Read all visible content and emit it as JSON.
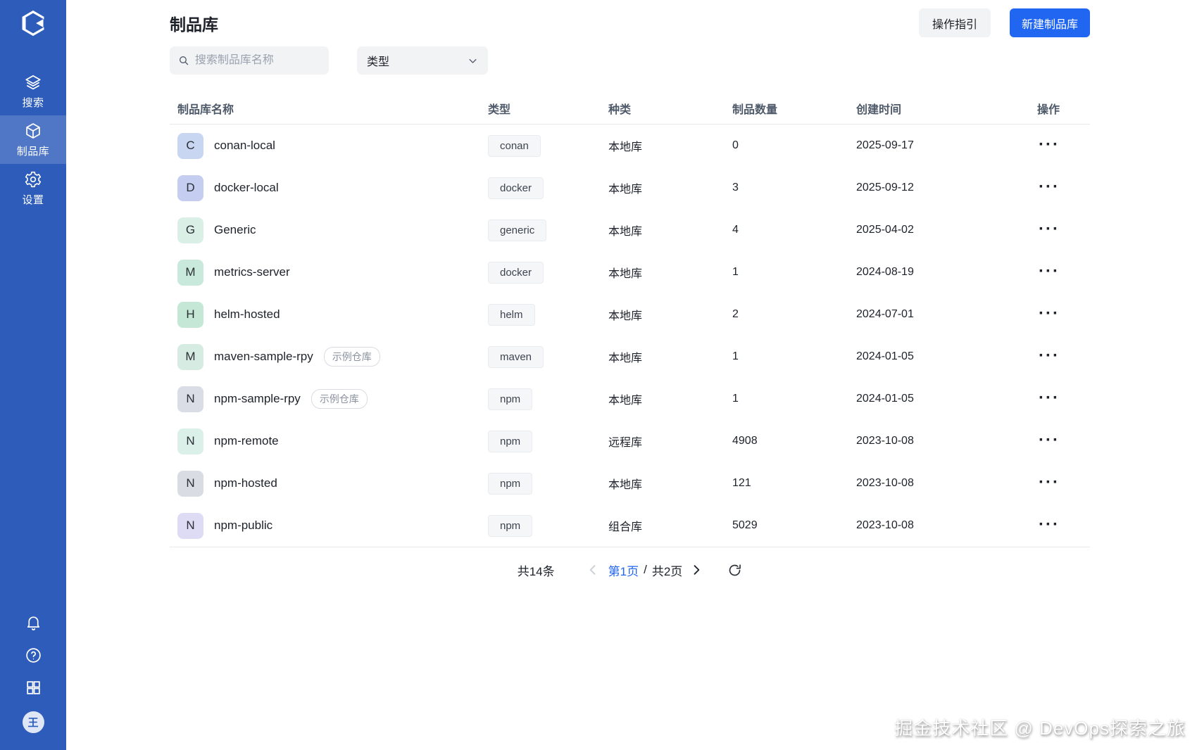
{
  "sidebar": {
    "items": [
      {
        "id": "search",
        "label": "搜索",
        "active": false
      },
      {
        "id": "artifacts",
        "label": "制品库",
        "active": true
      },
      {
        "id": "settings",
        "label": "设置",
        "active": false
      }
    ],
    "avatar_text": "王"
  },
  "header": {
    "title": "制品库",
    "guide_button_label": "操作指引",
    "create_button_label": "新建制品库"
  },
  "filters": {
    "search_placeholder": "搜索制品库名称",
    "search_value": "",
    "type_filter_label": "类型"
  },
  "table": {
    "columns": [
      "制品库名称",
      "类型",
      "种类",
      "制品数量",
      "创建时间",
      "操作"
    ],
    "action_label": "···",
    "rows": [
      {
        "initial": "C",
        "avatar_color": "#c9d6f2",
        "name": "conan-local",
        "badge": "",
        "type": "conan",
        "kind": "本地库",
        "count": "0",
        "created": "2025-09-17"
      },
      {
        "initial": "D",
        "avatar_color": "#c5cdf0",
        "name": "docker-local",
        "badge": "",
        "type": "docker",
        "kind": "本地库",
        "count": "3",
        "created": "2025-09-12"
      },
      {
        "initial": "G",
        "avatar_color": "#daf0e7",
        "name": "Generic",
        "badge": "",
        "type": "generic",
        "kind": "本地库",
        "count": "4",
        "created": "2025-04-02"
      },
      {
        "initial": "M",
        "avatar_color": "#c8e9db",
        "name": "metrics-server",
        "badge": "",
        "type": "docker",
        "kind": "本地库",
        "count": "1",
        "created": "2024-08-19"
      },
      {
        "initial": "H",
        "avatar_color": "#c4e7d6",
        "name": "helm-hosted",
        "badge": "",
        "type": "helm",
        "kind": "本地库",
        "count": "2",
        "created": "2024-07-01"
      },
      {
        "initial": "M",
        "avatar_color": "#d6ece3",
        "name": "maven-sample-rpy",
        "badge": "示例仓库",
        "type": "maven",
        "kind": "本地库",
        "count": "1",
        "created": "2024-01-05"
      },
      {
        "initial": "N",
        "avatar_color": "#dbdde6",
        "name": "npm-sample-rpy",
        "badge": "示例仓库",
        "type": "npm",
        "kind": "本地库",
        "count": "1",
        "created": "2024-01-05"
      },
      {
        "initial": "N",
        "avatar_color": "#daf0e9",
        "name": "npm-remote",
        "badge": "",
        "type": "npm",
        "kind": "远程库",
        "count": "4908",
        "created": "2023-10-08"
      },
      {
        "initial": "N",
        "avatar_color": "#d9dce3",
        "name": "npm-hosted",
        "badge": "",
        "type": "npm",
        "kind": "本地库",
        "count": "121",
        "created": "2023-10-08"
      },
      {
        "initial": "N",
        "avatar_color": "#dedcf5",
        "name": "npm-public",
        "badge": "",
        "type": "npm",
        "kind": "组合库",
        "count": "5029",
        "created": "2023-10-08"
      }
    ]
  },
  "pagination": {
    "total_items": "共14条",
    "current_page": "第1页",
    "separator": "/",
    "total_pages": "共2页"
  },
  "watermark": "掘金技术社区 @ DevOps探索之旅",
  "colors": {
    "sidebar_blue": "#2d5cba",
    "accent_blue": "#2166f0",
    "tag_background": "#f5f6f8",
    "input_background": "#f2f3f5"
  }
}
